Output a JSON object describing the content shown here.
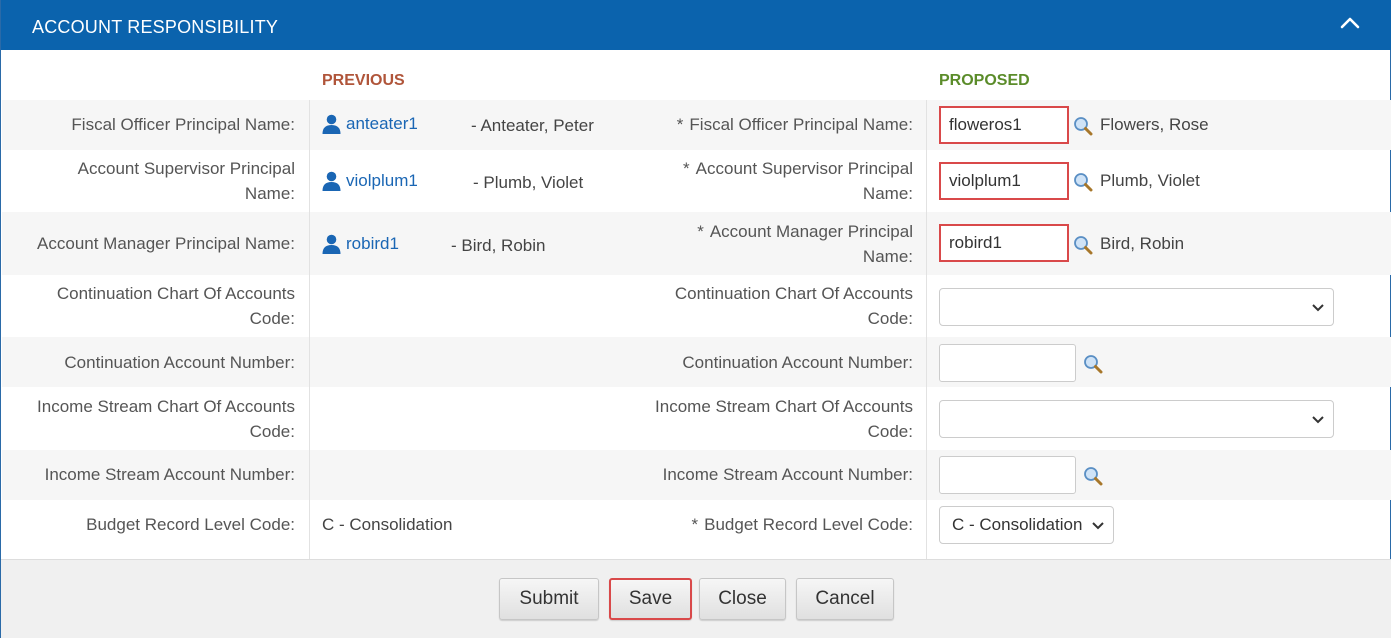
{
  "section": {
    "title": "ACCOUNT RESPONSIBILITY",
    "collapse_icon": "chevron-up-icon"
  },
  "columns": {
    "previous": "PREVIOUS",
    "proposed": "PROPOSED"
  },
  "rows": {
    "fiscal_officer": {
      "label": "Fiscal Officer Principal Name:",
      "required": "*",
      "prev_user": "anteater1",
      "prev_name": "- Anteater, Peter",
      "proposed_value": "floweros1",
      "proposed_name": "Flowers, Rose"
    },
    "account_supervisor": {
      "label_line1": "Account Supervisor Principal",
      "label_line2": "Name:",
      "required": "*",
      "prev_user": "violplum1",
      "prev_name": "- Plumb, Violet",
      "proposed_value": "violplum1",
      "proposed_name": "Plumb, Violet"
    },
    "account_manager": {
      "label_left": "Account Manager Principal Name:",
      "label_line1": "Account Manager Principal",
      "label_line2": "Name:",
      "required": "*",
      "prev_user": "robird1",
      "prev_name": "- Bird, Robin",
      "proposed_value": "robird1",
      "proposed_name": "Bird, Robin"
    },
    "continuation_chart": {
      "label_line1": "Continuation Chart Of Accounts",
      "label_line2": "Code:",
      "selected": ""
    },
    "continuation_account": {
      "label": "Continuation Account Number:",
      "value": ""
    },
    "income_stream_chart": {
      "label_line1": "Income Stream Chart Of Accounts",
      "label_line2": "Code:",
      "selected": ""
    },
    "income_stream_account": {
      "label": "Income Stream Account Number:",
      "value": ""
    },
    "budget_record_level": {
      "label": "Budget Record Level Code:",
      "required": "*",
      "prev_value": "C - Consolidation",
      "selected": "C - Consolidation"
    }
  },
  "footer": {
    "submit": "Submit",
    "save": "Save",
    "close": "Close",
    "cancel": "Cancel"
  },
  "colors": {
    "header_bg": "#0b63ad",
    "previous_heading": "#b0553a",
    "proposed_heading": "#5b8c2a",
    "link": "#1a66b4",
    "highlight_border": "#d9494a"
  }
}
